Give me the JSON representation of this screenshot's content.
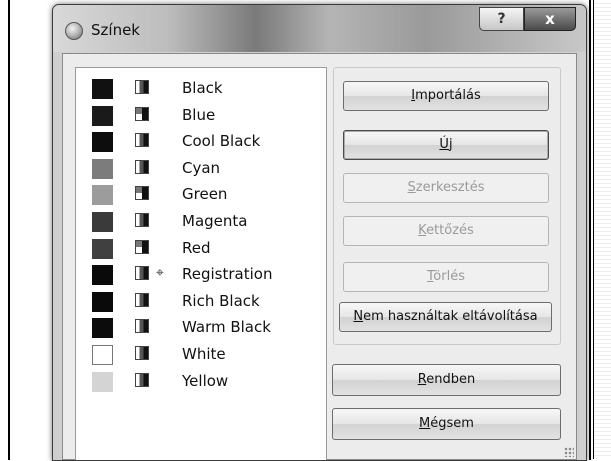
{
  "window": {
    "title": "Színek",
    "help_label": "?",
    "close_label": "x"
  },
  "swatches": [
    {
      "name": "Black",
      "color": "#111111",
      "mode": "cmyk",
      "reg": false
    },
    {
      "name": "Blue",
      "color": "#1a1a1a",
      "mode": "rgb",
      "reg": false
    },
    {
      "name": "Cool Black",
      "color": "#0d0d0d",
      "mode": "cmyk",
      "reg": false
    },
    {
      "name": "Cyan",
      "color": "#7c7c7c",
      "mode": "cmyk",
      "reg": false
    },
    {
      "name": "Green",
      "color": "#9c9c9c",
      "mode": "rgb",
      "reg": false
    },
    {
      "name": "Magenta",
      "color": "#3a3a3a",
      "mode": "cmyk",
      "reg": false
    },
    {
      "name": "Red",
      "color": "#404040",
      "mode": "rgb",
      "reg": false
    },
    {
      "name": "Registration",
      "color": "#0a0a0a",
      "mode": "cmyk",
      "reg": true
    },
    {
      "name": "Rich Black",
      "color": "#0a0a0a",
      "mode": "cmyk",
      "reg": false
    },
    {
      "name": "Warm Black",
      "color": "#0c0c0c",
      "mode": "cmyk",
      "reg": false
    },
    {
      "name": "White",
      "color": "#ffffff",
      "mode": "cmyk",
      "reg": false
    },
    {
      "name": "Yellow",
      "color": "#d4d4d4",
      "mode": "cmyk",
      "reg": false
    }
  ],
  "buttons": {
    "import": {
      "label": "Importálás",
      "accel": "I",
      "rest": "mportálás"
    },
    "new": {
      "label": "Új",
      "accel": "Ú",
      "rest": "j"
    },
    "edit": {
      "label": "Szerkesztés",
      "accel": "S",
      "rest": "zerkesztés"
    },
    "duplicate": {
      "label": "Kettőzés",
      "accel": "K",
      "rest": "ettőzés"
    },
    "delete": {
      "label": "Törlés",
      "accel": "T",
      "rest": "örlés"
    },
    "remove_unused": {
      "label": "Nem használtak eltávolítása",
      "accel": "N",
      "rest": "em használtak eltávolítása"
    },
    "ok": {
      "label": "Rendben",
      "accel": "R",
      "rest": "endben"
    },
    "cancel": {
      "label": "Mégsem",
      "accel": "M",
      "rest": "égsem"
    }
  },
  "icons": {
    "window": "app-icon",
    "registration": "crosshair-icon"
  }
}
